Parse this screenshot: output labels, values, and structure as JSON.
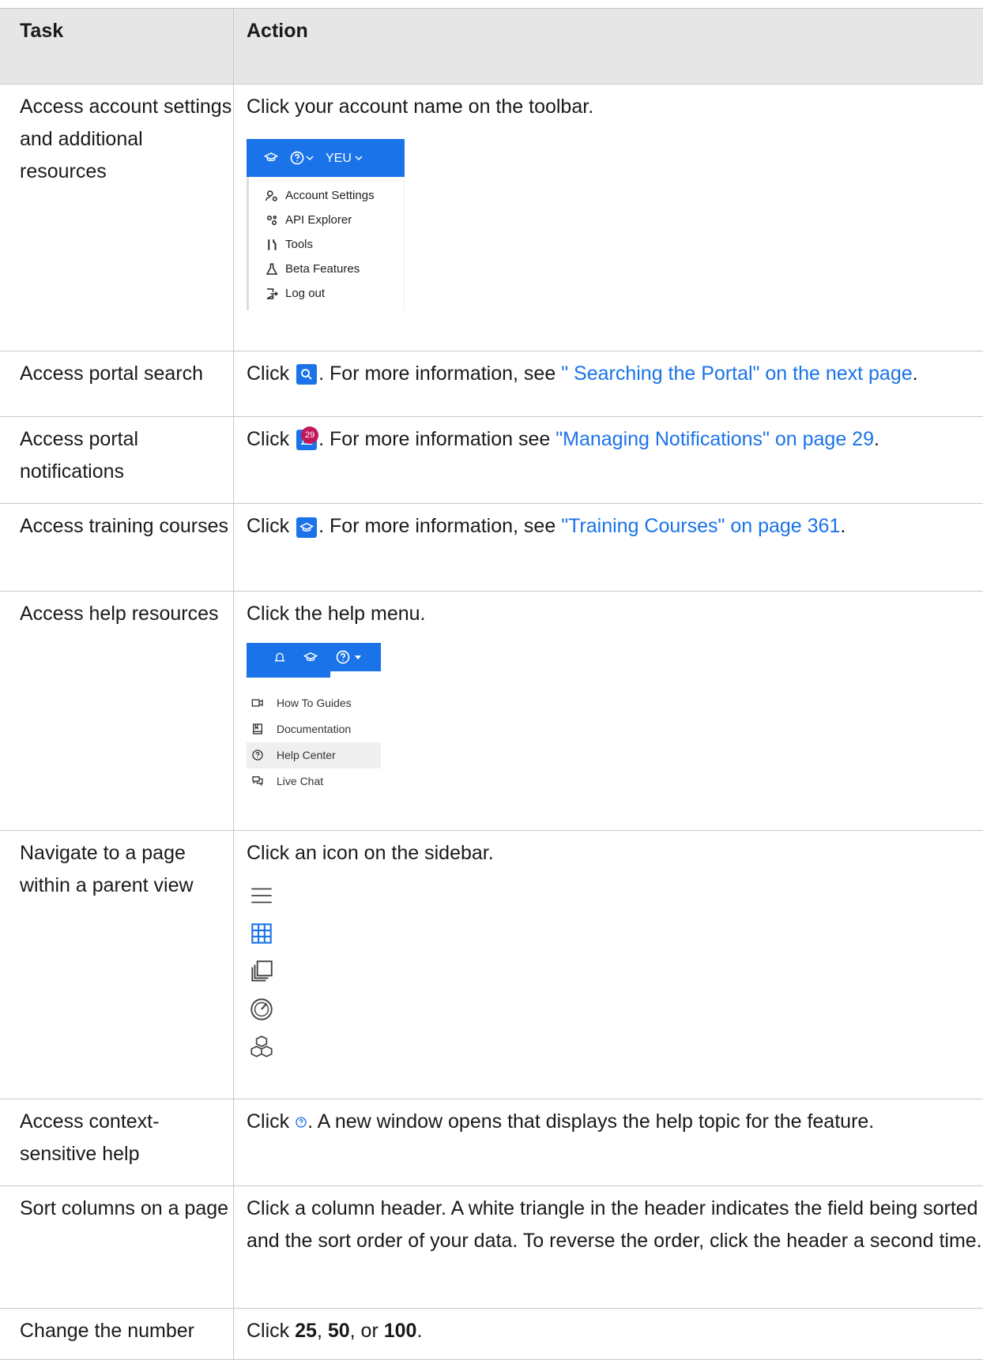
{
  "table": {
    "header": {
      "task": "Task",
      "action": "Action"
    },
    "rows": {
      "r0": {
        "task": "Access account settings and additional resources",
        "action": "Click your account name on the toolbar.",
        "menu": {
          "user": "YEU",
          "items": [
            "Account Settings",
            "API Explorer",
            "Tools",
            "Beta Features",
            "Log out"
          ]
        }
      },
      "r1": {
        "task": "Access portal search",
        "action_prefix": "Click",
        "action_mid": ". For more information, see",
        "link": "\" Searching the Portal\" on the next page",
        "action_suffix": "."
      },
      "r2": {
        "task": "Access portal notifications",
        "action_prefix": "Click",
        "badge": "29",
        "action_mid": ". For more information see",
        "link": "\"Managing Notifications\" on page 29",
        "action_suffix": "."
      },
      "r3": {
        "task": "Access training courses",
        "action_prefix": "Click",
        "action_mid": ". For more information, see",
        "link": "\"Training Courses\" on page 361",
        "action_suffix": "."
      },
      "r4": {
        "task": "Access help resources",
        "action": "Click the help menu.",
        "menu": {
          "items": [
            "How To Guides",
            "Documentation",
            "Help Center",
            "Live Chat"
          ]
        }
      },
      "r5": {
        "task": "Navigate to a page within a parent view",
        "action": "Click an icon on the sidebar."
      },
      "r6": {
        "task": "Access context-sensitive help",
        "action_prefix": "Click",
        "action_suffix": ". A new window opens that displays the help topic for the feature."
      },
      "r7": {
        "task": "Sort columns on a page",
        "action": "Click a column header. A white triangle in the header indicates the field being sorted and the sort order of your data. To reverse the order, click the header a second time."
      },
      "r8": {
        "task": "Change the number",
        "action_prefix": "Click",
        "n1": "25",
        "sep1": ",",
        "n2": "50",
        "sep2": ", or",
        "n3": "100",
        "end": "."
      }
    }
  },
  "colors": {
    "accent": "#1a73e8",
    "badge": "#c2185b",
    "header_bg": "#e6e6e6"
  }
}
